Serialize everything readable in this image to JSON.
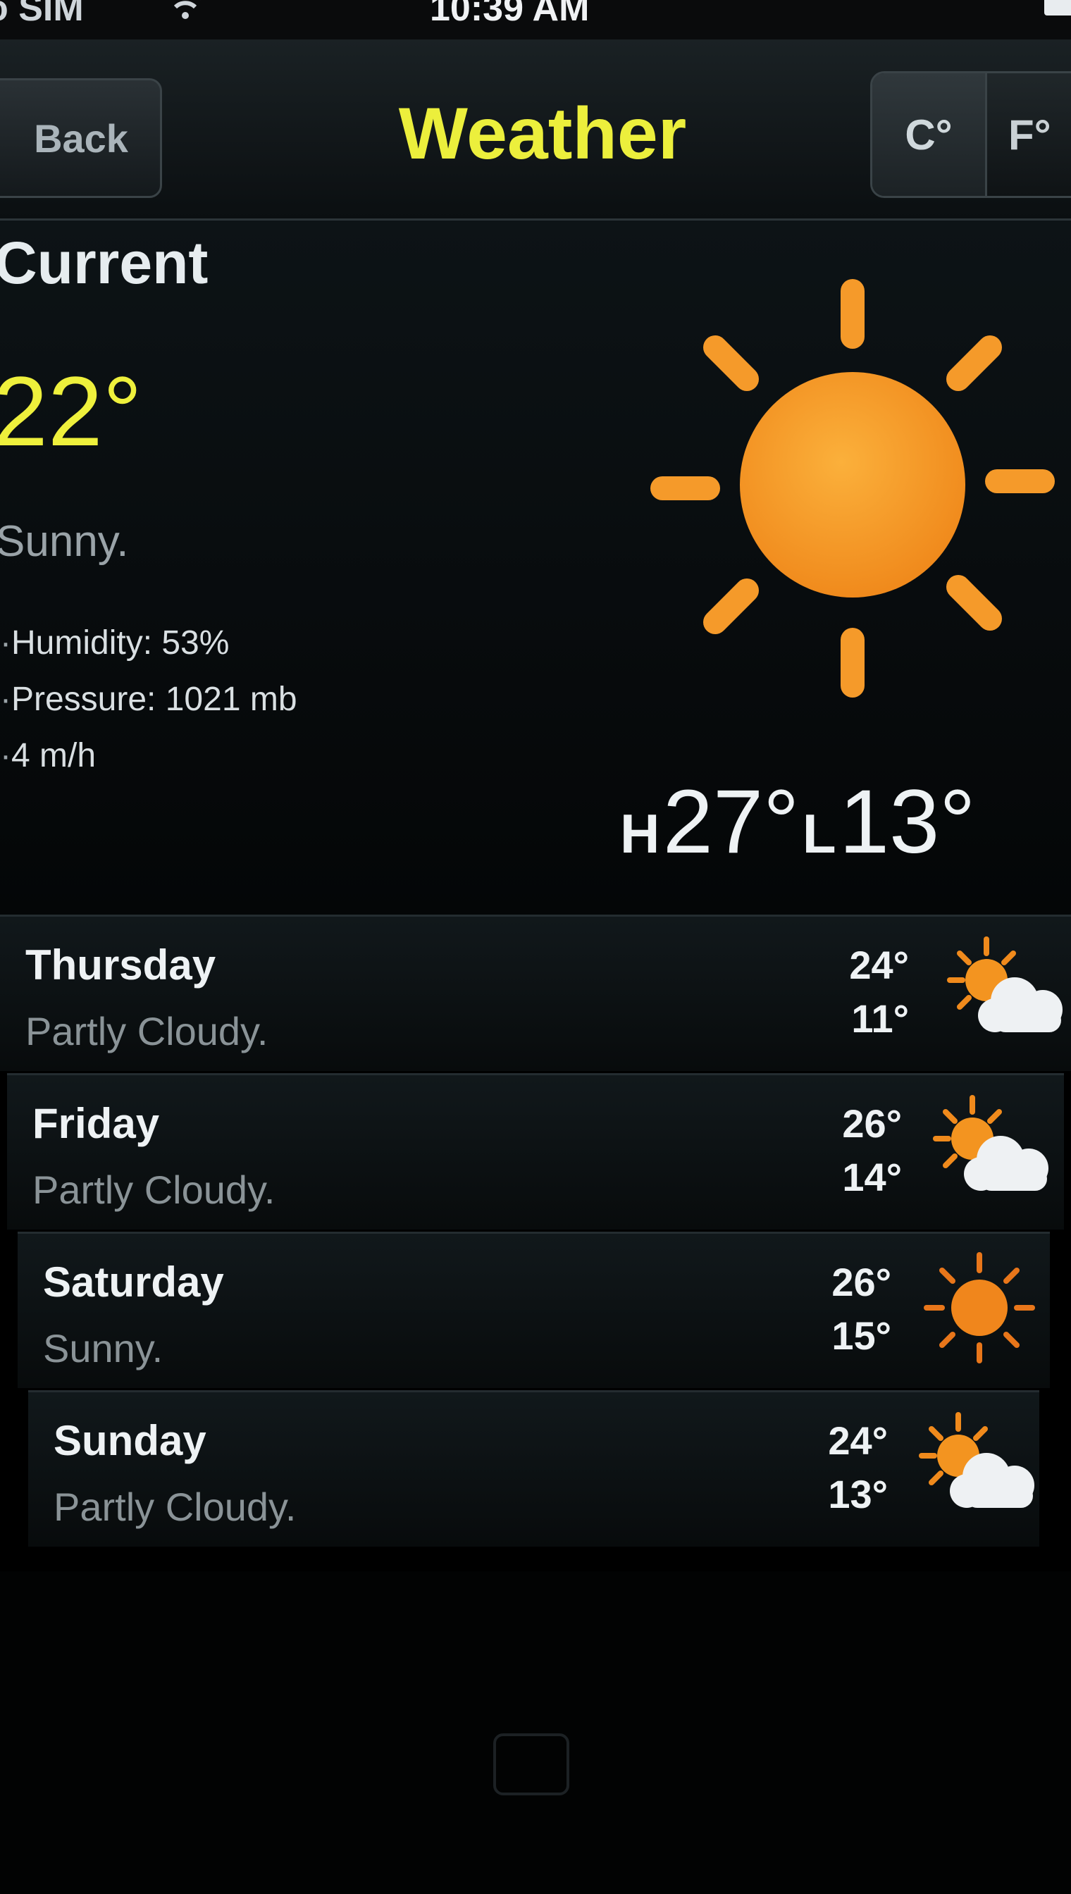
{
  "status_bar": {
    "carrier": "o SIM",
    "time": "10:39 AM",
    "wifi_icon": "wifi-icon",
    "battery_icon": "battery-icon"
  },
  "nav": {
    "back_label": "Back",
    "title": "Weather",
    "unit_c": "C°",
    "unit_f": "F°"
  },
  "current": {
    "heading": "Current",
    "temperature": "22°",
    "condition": "Sunny.",
    "details": [
      "Humidity: 53%",
      "Pressure: 1021 mb",
      "4 m/h"
    ],
    "icon": "sun-icon",
    "high_label": "H",
    "high": "27°",
    "low_label": "L",
    "low": "13°"
  },
  "forecast": [
    {
      "day": "Thursday",
      "condition": "Partly Cloudy.",
      "high": "24°",
      "low": "11°",
      "icon": "partly-cloudy-icon"
    },
    {
      "day": "Friday",
      "condition": "Partly Cloudy.",
      "high": "26°",
      "low": "14°",
      "icon": "partly-cloudy-icon"
    },
    {
      "day": "Saturday",
      "condition": "Sunny.",
      "high": "26°",
      "low": "15°",
      "icon": "sun-icon"
    },
    {
      "day": "Sunday",
      "condition": "Partly Cloudy.",
      "high": "24°",
      "low": "13°",
      "icon": "partly-cloudy-icon"
    }
  ],
  "colors": {
    "title_yellow": "#ecef3c",
    "temp_yellow": "#eef03c",
    "sun_orange": "#f79a22",
    "background": "#000000"
  }
}
